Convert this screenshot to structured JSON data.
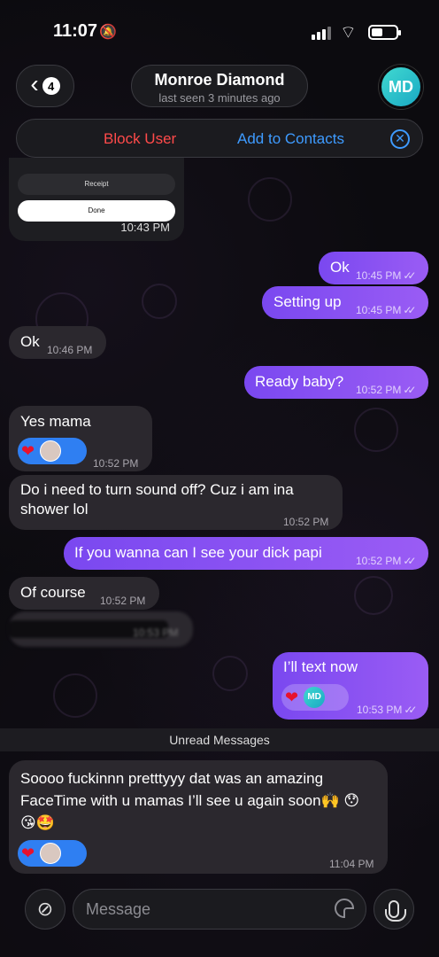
{
  "status_bar": {
    "time": "11:07",
    "bell": "🔕",
    "wifi": "⌔"
  },
  "header": {
    "back_count": "4",
    "back_chevron": "‹",
    "name": "Monroe Diamond",
    "last_seen": "last seen 3 minutes ago",
    "avatar_initials": "MD"
  },
  "actions": {
    "block": "Block User",
    "add": "Add to Contacts",
    "close": "✕"
  },
  "receipt_card": {
    "receipt": "Receipt",
    "done": "Done",
    "time": "10:43 PM"
  },
  "messages": [
    {
      "text": "Ok",
      "time": "10:45 PM"
    },
    {
      "text": "Setting up",
      "time": "10:45 PM"
    },
    {
      "text": "Ok",
      "time": "10:46 PM"
    },
    {
      "text": "Ready baby?",
      "time": "10:52 PM"
    },
    {
      "text": "Yes mama",
      "time": "10:52 PM"
    },
    {
      "text": "Do i need to turn sound off? Cuz i am ina shower lol",
      "time": "10:52 PM"
    },
    {
      "text": "If you wanna can I see your dick papi",
      "time": "10:52 PM"
    },
    {
      "text": "Of course",
      "time": "10:52 PM"
    },
    {
      "text": "",
      "time": "10:53 PM"
    },
    {
      "text": "I’ll text now",
      "time": "10:53 PM"
    },
    {
      "text": "Soooo fuckinnn pretttyyy dat was an amazing FaceTime with u mamas I’ll see u again soon🙌 😯😘🤩",
      "time": "11:04 PM"
    }
  ],
  "reactions": {
    "heart": "❤",
    "md": "MD"
  },
  "ticks": "✓✓",
  "unread_label": "Unread Messages",
  "input": {
    "placeholder": "Message",
    "attach_icon": "⊘"
  }
}
